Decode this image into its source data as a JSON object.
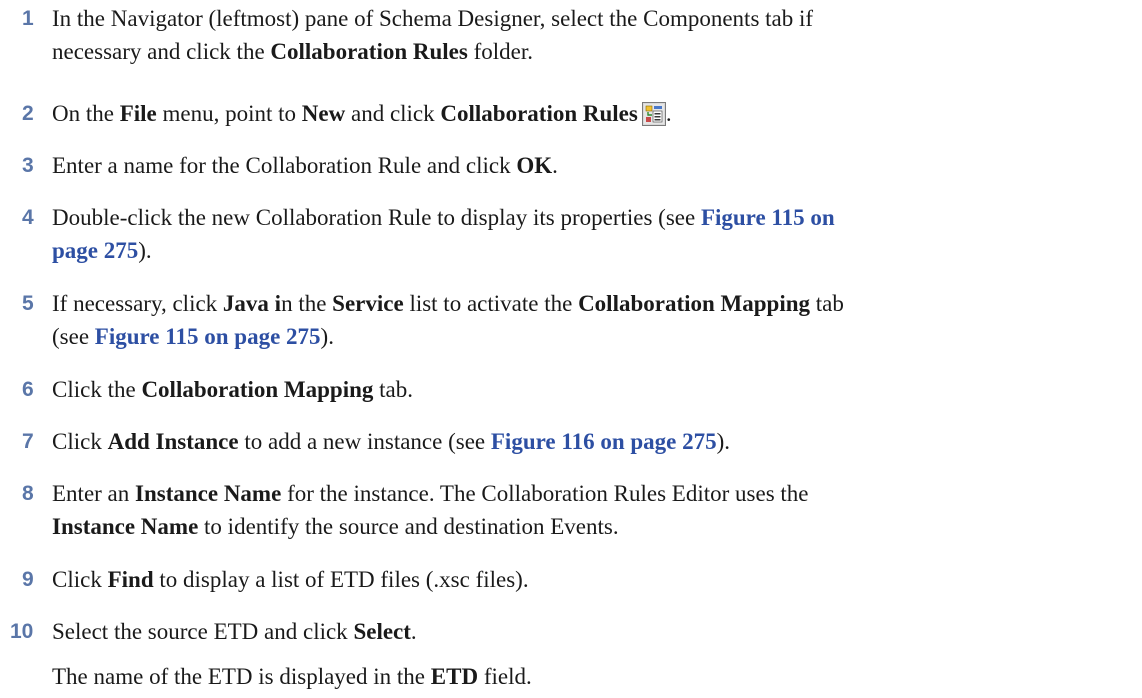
{
  "steps": [
    {
      "number": "1",
      "line1": [
        "In the Navigator (leftmost) pane of Schema Designer, select the Components tab if"
      ],
      "line2_a": "necessary and click the ",
      "line2_b": "Collaboration Rules",
      "line2_c": " folder."
    },
    {
      "number": "2",
      "a": "On the ",
      "b": "File",
      "c": " menu, point to ",
      "d": "New",
      "e": " and click ",
      "f": "Collaboration Rules",
      "g": ".",
      "icon": "collaboration-rules-icon"
    },
    {
      "number": "3",
      "a": "Enter a name for the Collaboration Rule and click ",
      "b": "OK",
      "c": "."
    },
    {
      "number": "4",
      "a": "Double-click the new Collaboration Rule to display its properties (see ",
      "b": "Figure 115 on",
      "c": "page 275",
      "d": ")."
    },
    {
      "number": "5",
      "a": "If necessary, click ",
      "b": "Java i",
      "c": "n the ",
      "d": "Service",
      "e": " list to activate the ",
      "f": "Collaboration Mapping",
      "g": " tab",
      "h": "(see ",
      "i": "Figure 115 on page 275",
      "j": ")."
    },
    {
      "number": "6",
      "a": "Click the ",
      "b": "Collaboration Mapping",
      "c": " tab."
    },
    {
      "number": "7",
      "a": "Click ",
      "b": "Add Instance",
      "c": " to add a new instance (see ",
      "d": "Figure 116 on page 275",
      "e": ")."
    },
    {
      "number": "8",
      "a": "Enter an ",
      "b": "Instance Name",
      "c": " for the instance. The Collaboration Rules Editor uses the",
      "d": "Instance Name",
      "e": " to identify the source and destination Events."
    },
    {
      "number": "9",
      "a": "Click ",
      "b": "Find",
      "c": " to display a list of ETD files (.xsc files)."
    },
    {
      "number": "10",
      "a": "Select the source ETD and click ",
      "b": "Select",
      "c": "."
    }
  ],
  "trailing": {
    "a": "The name of the ETD is displayed in the ",
    "b": "ETD",
    "c": " field."
  },
  "colors": {
    "step_number": "#5a76a8",
    "cross_reference": "#2d4fa3",
    "body_text": "#1a1a1a"
  }
}
